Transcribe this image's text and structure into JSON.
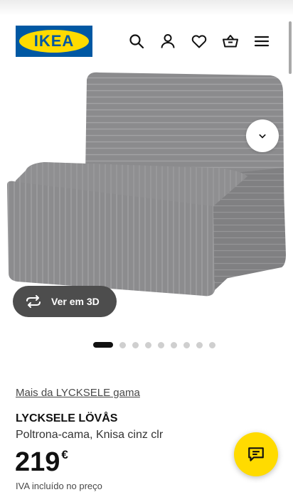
{
  "header": {
    "logo_text": "IKEA",
    "icons": [
      "search-icon",
      "user-icon",
      "heart-icon",
      "basket-icon",
      "menu-icon"
    ]
  },
  "gallery": {
    "view_3d_label": "Ver em 3D",
    "image_count": 9,
    "active_index": 0
  },
  "product": {
    "range_link": "Mais da LYCKSELE gama",
    "name": "LYCKSELE LÖVÅS",
    "description": "Poltrona-cama, Knisa cinz clr",
    "price": "219",
    "currency": "€",
    "vat_note": "IVA incluído no preço"
  },
  "colors": {
    "brand_blue": "#0058a3",
    "brand_yellow": "#ffdb00",
    "fabric_grey": "#8e8e90"
  }
}
